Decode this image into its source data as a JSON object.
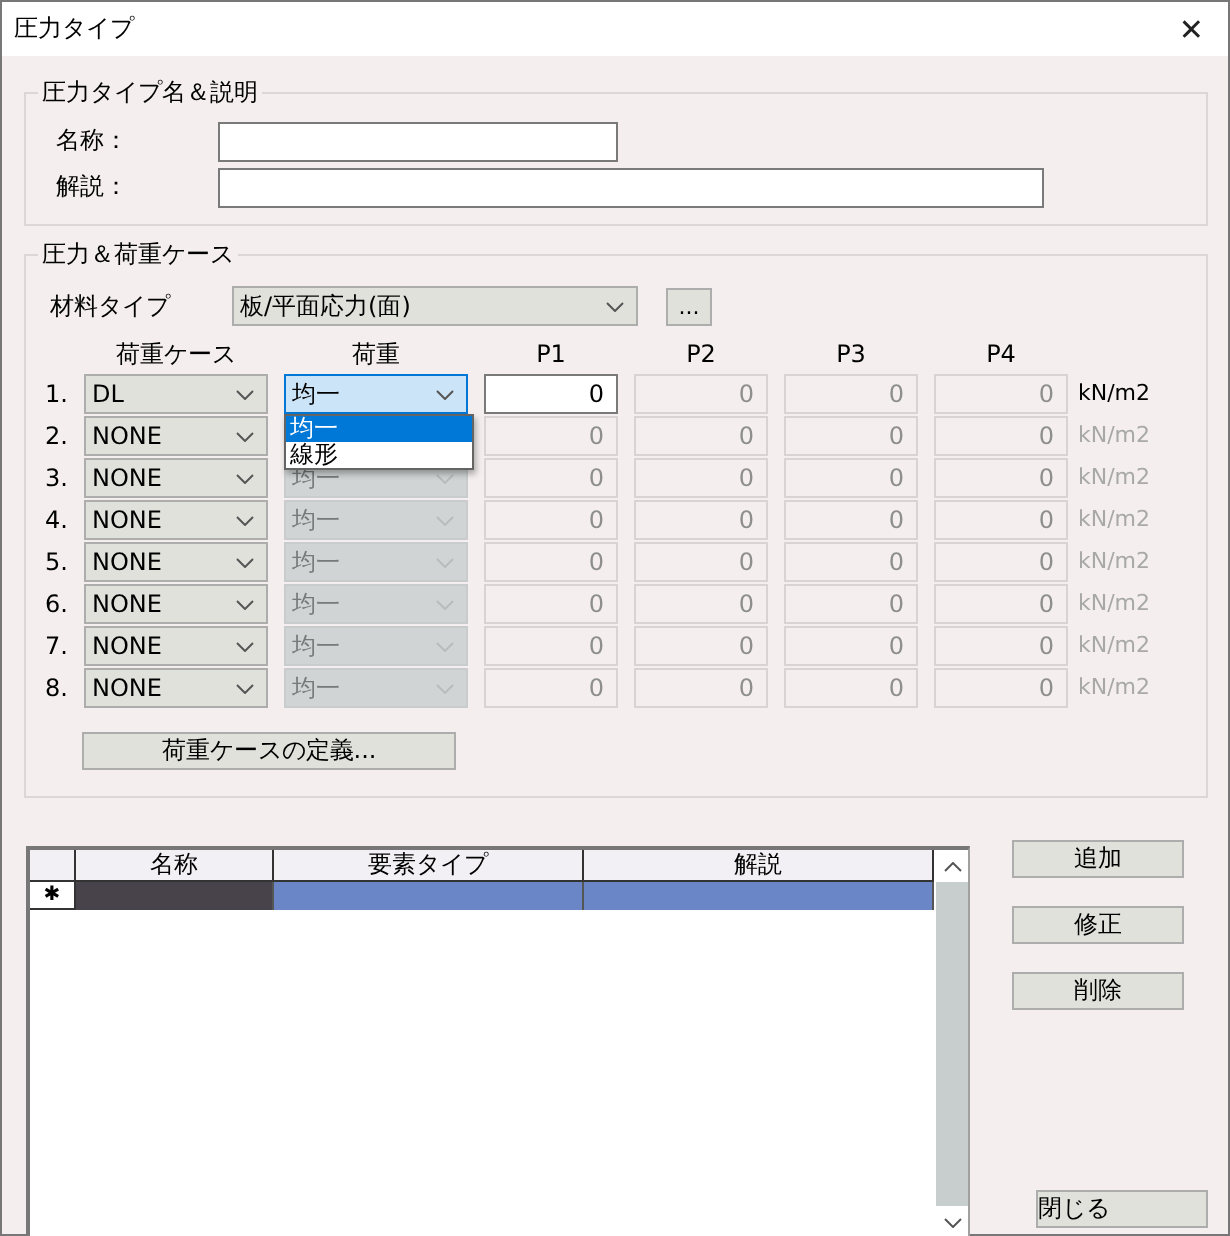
{
  "window": {
    "title": "圧力タイプ",
    "close": "✕"
  },
  "name_group": {
    "title": "圧力タイプ名＆説明",
    "fields": [
      {
        "label": "名称："
      },
      {
        "label": "解説："
      }
    ]
  },
  "load_group": {
    "title": "圧力＆荷重ケース",
    "material": {
      "label": "材料タイプ",
      "value": "板/平面応力(面)",
      "browse": "..."
    },
    "headers": [
      "荷重ケース",
      "荷重",
      "P1",
      "P2",
      "P3",
      "P4"
    ],
    "rows": [
      {
        "number": "1.",
        "case": "DL",
        "load": "均一",
        "load_disabled": false,
        "load_focused": true,
        "p": [
          {
            "value": "0",
            "disabled": false
          },
          {
            "value": "0",
            "disabled": true
          },
          {
            "value": "0",
            "disabled": true
          },
          {
            "value": "0",
            "disabled": true
          }
        ],
        "unit": "kN/m2",
        "unit_disabled": false
      },
      {
        "number": "2.",
        "case": "NONE",
        "p": [
          {
            "value": "0",
            "disabled": true
          },
          {
            "value": "0",
            "disabled": true
          },
          {
            "value": "0",
            "disabled": true
          },
          {
            "value": "0",
            "disabled": true
          }
        ],
        "unit": "kN/m2",
        "unit_disabled": true
      },
      {
        "number": "3.",
        "case": "NONE",
        "load": "均一",
        "load_disabled": true,
        "load_focused": false,
        "p": [
          {
            "value": "0",
            "disabled": true
          },
          {
            "value": "0",
            "disabled": true
          },
          {
            "value": "0",
            "disabled": true
          },
          {
            "value": "0",
            "disabled": true
          }
        ],
        "unit": "kN/m2",
        "unit_disabled": true
      },
      {
        "number": "4.",
        "case": "NONE",
        "load": "均一",
        "load_disabled": true,
        "load_focused": false,
        "p": [
          {
            "value": "0",
            "disabled": true
          },
          {
            "value": "0",
            "disabled": true
          },
          {
            "value": "0",
            "disabled": true
          },
          {
            "value": "0",
            "disabled": true
          }
        ],
        "unit": "kN/m2",
        "unit_disabled": true
      },
      {
        "number": "5.",
        "case": "NONE",
        "load": "均一",
        "load_disabled": true,
        "load_focused": false,
        "p": [
          {
            "value": "0",
            "disabled": true
          },
          {
            "value": "0",
            "disabled": true
          },
          {
            "value": "0",
            "disabled": true
          },
          {
            "value": "0",
            "disabled": true
          }
        ],
        "unit": "kN/m2",
        "unit_disabled": true
      },
      {
        "number": "6.",
        "case": "NONE",
        "load": "均一",
        "load_disabled": true,
        "load_focused": false,
        "p": [
          {
            "value": "0",
            "disabled": true
          },
          {
            "value": "0",
            "disabled": true
          },
          {
            "value": "0",
            "disabled": true
          },
          {
            "value": "0",
            "disabled": true
          }
        ],
        "unit": "kN/m2",
        "unit_disabled": true
      },
      {
        "number": "7.",
        "case": "NONE",
        "load": "均一",
        "load_disabled": true,
        "load_focused": false,
        "p": [
          {
            "value": "0",
            "disabled": true
          },
          {
            "value": "0",
            "disabled": true
          },
          {
            "value": "0",
            "disabled": true
          },
          {
            "value": "0",
            "disabled": true
          }
        ],
        "unit": "kN/m2",
        "unit_disabled": true
      },
      {
        "number": "8.",
        "case": "NONE",
        "load": "均一",
        "load_disabled": true,
        "load_focused": false,
        "p": [
          {
            "value": "0",
            "disabled": true
          },
          {
            "value": "0",
            "disabled": true
          },
          {
            "value": "0",
            "disabled": true
          },
          {
            "value": "0",
            "disabled": true
          }
        ],
        "unit": "kN/m2",
        "unit_disabled": true
      }
    ],
    "load_options": [
      {
        "label": "均一",
        "selected": true
      },
      {
        "label": "線形",
        "selected": false
      }
    ],
    "define_button": "荷重ケースの定義..."
  },
  "table": {
    "columns": [
      "名称",
      "要素タイプ",
      "解説"
    ],
    "new_row": {
      "marker": "✱",
      "selected": true,
      "cells": [
        {
          "current": true
        },
        {
          "current": false
        },
        {
          "current": false
        }
      ]
    }
  },
  "buttons": [
    {
      "label": "追加",
      "kind": "top"
    },
    {
      "label": "修正",
      "kind": "top"
    },
    {
      "label": "削除",
      "kind": "top"
    },
    {
      "label": "閉じる",
      "kind": "bottom"
    }
  ]
}
